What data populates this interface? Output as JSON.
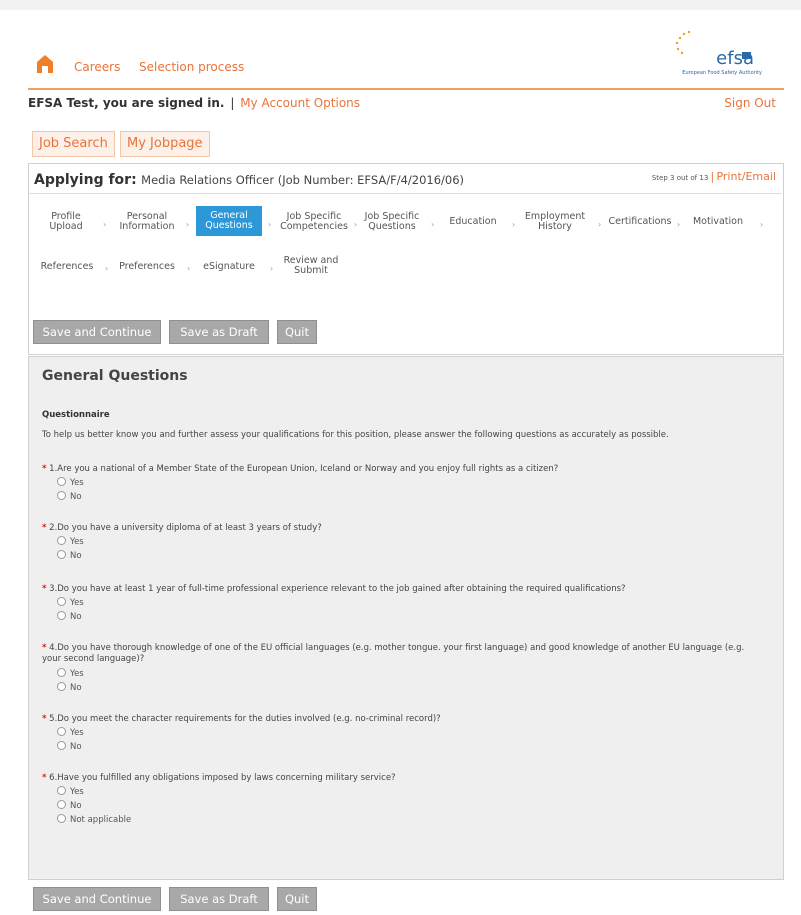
{
  "header": {
    "nav": [
      "Careers",
      "Selection process"
    ],
    "logo_text": "efsa",
    "logo_sub": "European Food Safety Authority"
  },
  "signed_in": {
    "text": "EFSA Test, you are signed in.",
    "separator": "|",
    "account_link": "My Account Options",
    "sign_out": "Sign Out"
  },
  "tabs": [
    "Job Search",
    "My Jobpage"
  ],
  "applying": {
    "label": "Applying for:",
    "position": "Media Relations Officer (Job Number: EFSA/F/4/2016/06)",
    "step": "Step 3 out of 13",
    "separator": "|",
    "print_email": "Print/Email"
  },
  "steps": {
    "row1": [
      "Profile\nUpload",
      "Personal\nInformation",
      "General\nQuestions",
      "Job Specific\nCompetencies",
      "Job Specific\nQuestions",
      "Education",
      "Employment\nHistory",
      "Certifications",
      "Motivation"
    ],
    "row2": [
      "References",
      "Preferences",
      "eSignature",
      "Review and\nSubmit"
    ]
  },
  "buttons": {
    "save_continue": "Save and Continue",
    "save_draft": "Save as Draft",
    "quit": "Quit"
  },
  "section": {
    "title": "General Questions",
    "questionnaire": "Questionnaire",
    "intro": "To help us better know you and further assess your qualifications for this position, please answer the following questions as accurately as possible."
  },
  "questions": [
    {
      "text": "1.Are you a national of a Member State of the European Union, Iceland or Norway and you enjoy full rights as a citizen?",
      "options": [
        "Yes",
        "No"
      ]
    },
    {
      "text": "2.Do you have a university diploma of at least 3 years of study?",
      "options": [
        "Yes",
        "No"
      ]
    },
    {
      "text": "3.Do you have at least 1 year of full-time professional experience relevant to the job gained after obtaining the required qualifications?",
      "options": [
        "Yes",
        "No"
      ]
    },
    {
      "text": "4.Do you have thorough knowledge of one of the EU official languages (e.g. mother tongue. your first language) and good knowledge of another EU language (e.g. your second language)?",
      "options": [
        "Yes",
        "No"
      ]
    },
    {
      "text": "5.Do you meet the character requirements for the duties involved (e.g. no-criminal record)?",
      "options": [
        "Yes",
        "No"
      ]
    },
    {
      "text": "6.Have you fulfilled any obligations imposed by laws concerning military service?",
      "options": [
        "Yes",
        "No",
        "Not applicable"
      ]
    }
  ],
  "required_mark": "*",
  "colors": {
    "accent": "#e8743b",
    "active_step": "#2d98d8",
    "button": "#a8a8a8"
  }
}
